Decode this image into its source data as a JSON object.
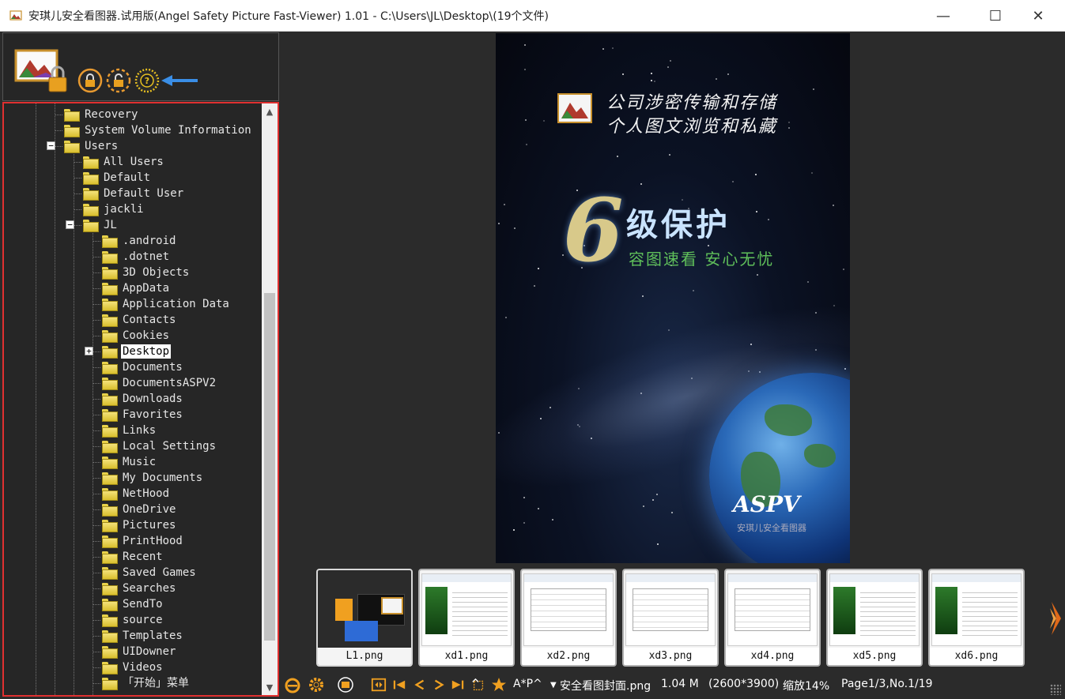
{
  "window": {
    "title": "安琪儿安全看图器.试用版(Angel Safety Picture Fast-Viewer) 1.01 - C:\\Users\\JL\\Desktop\\(19个文件)",
    "min_glyph": "—",
    "max_glyph": "☐",
    "close_glyph": "✕"
  },
  "colors": {
    "tree_border": "#e03030",
    "folder_yellow": "#f4e27a",
    "arrow_blue": "#3a8ee6"
  },
  "tree": {
    "items": [
      {
        "label": "Recovery"
      },
      {
        "label": "System Volume Information"
      },
      {
        "label": "Users",
        "expander": "−"
      },
      {
        "label": "All Users"
      },
      {
        "label": "Default"
      },
      {
        "label": "Default User"
      },
      {
        "label": "jackli"
      },
      {
        "label": "JL",
        "expander": "−"
      },
      {
        "label": ".android"
      },
      {
        "label": ".dotnet"
      },
      {
        "label": "3D Objects"
      },
      {
        "label": "AppData"
      },
      {
        "label": "Application Data"
      },
      {
        "label": "Contacts"
      },
      {
        "label": "Cookies"
      },
      {
        "label": "Desktop",
        "expander": "+",
        "selected": true
      },
      {
        "label": "Documents"
      },
      {
        "label": "DocumentsASPV2"
      },
      {
        "label": "Downloads"
      },
      {
        "label": "Favorites"
      },
      {
        "label": "Links"
      },
      {
        "label": "Local Settings"
      },
      {
        "label": "Music"
      },
      {
        "label": "My Documents"
      },
      {
        "label": "NetHood"
      },
      {
        "label": "OneDrive"
      },
      {
        "label": "Pictures"
      },
      {
        "label": "PrintHood"
      },
      {
        "label": "Recent"
      },
      {
        "label": "Saved Games"
      },
      {
        "label": "Searches"
      },
      {
        "label": "SendTo"
      },
      {
        "label": "source"
      },
      {
        "label": "Templates"
      },
      {
        "label": "UIDowner"
      },
      {
        "label": "Videos"
      },
      {
        "label": "「开始」菜单"
      }
    ]
  },
  "poster": {
    "slogan_line1": "公司涉密传输和存储",
    "slogan_line2": "个人图文浏览和私藏",
    "big_number": "6",
    "level_text": "级保护",
    "sub_text": "容图速看 安心无忧",
    "brand": "ASPV",
    "team": "安琪儿安全看图器"
  },
  "thumbnails": [
    {
      "name": "L1.png",
      "active": true
    },
    {
      "name": "xd1.png"
    },
    {
      "name": "xd2.png"
    },
    {
      "name": "xd3.png"
    },
    {
      "name": "xd4.png"
    },
    {
      "name": "xd5.png"
    },
    {
      "name": "xd6.png"
    }
  ],
  "status": {
    "ap_label": "A*P^",
    "filename": "安全看图封面.png",
    "filesize": "1.04 M",
    "dimensions": "(2600*3900)",
    "zoom": "缩放14%",
    "page": "Page1/3,No.1/19"
  },
  "icons": {
    "app": "app-picture-icon",
    "lock_big": "picture-lock-icon",
    "lock": "lock-icon",
    "unlock": "unlock-icon",
    "help": "help-icon",
    "arrow": "left-arrow-icon"
  }
}
